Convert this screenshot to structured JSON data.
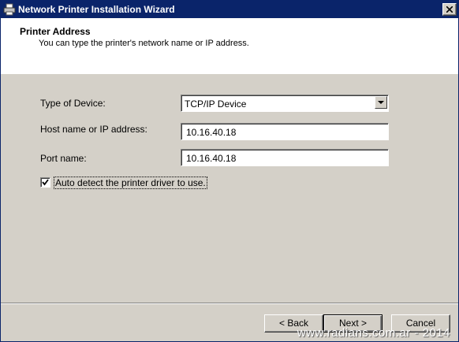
{
  "window": {
    "title": "Network Printer Installation Wizard"
  },
  "header": {
    "title": "Printer Address",
    "subtitle": "You can type the printer's network name or IP address."
  },
  "form": {
    "device_type": {
      "label": "Type of Device:",
      "value": "TCP/IP Device"
    },
    "host": {
      "label": "Host name or IP address:",
      "value": "10.16.40.18"
    },
    "port": {
      "label": "Port name:",
      "value": "10.16.40.18"
    },
    "auto_detect": {
      "label": "Auto detect the printer driver to use.",
      "checked": true
    }
  },
  "buttons": {
    "back": "< Back",
    "next": "Next >",
    "cancel": "Cancel"
  },
  "watermark": "www.radians.com.ar - 2014",
  "colors": {
    "titlebar": "#0a246a",
    "face": "#d4d0c8",
    "header": "#ffffff"
  }
}
